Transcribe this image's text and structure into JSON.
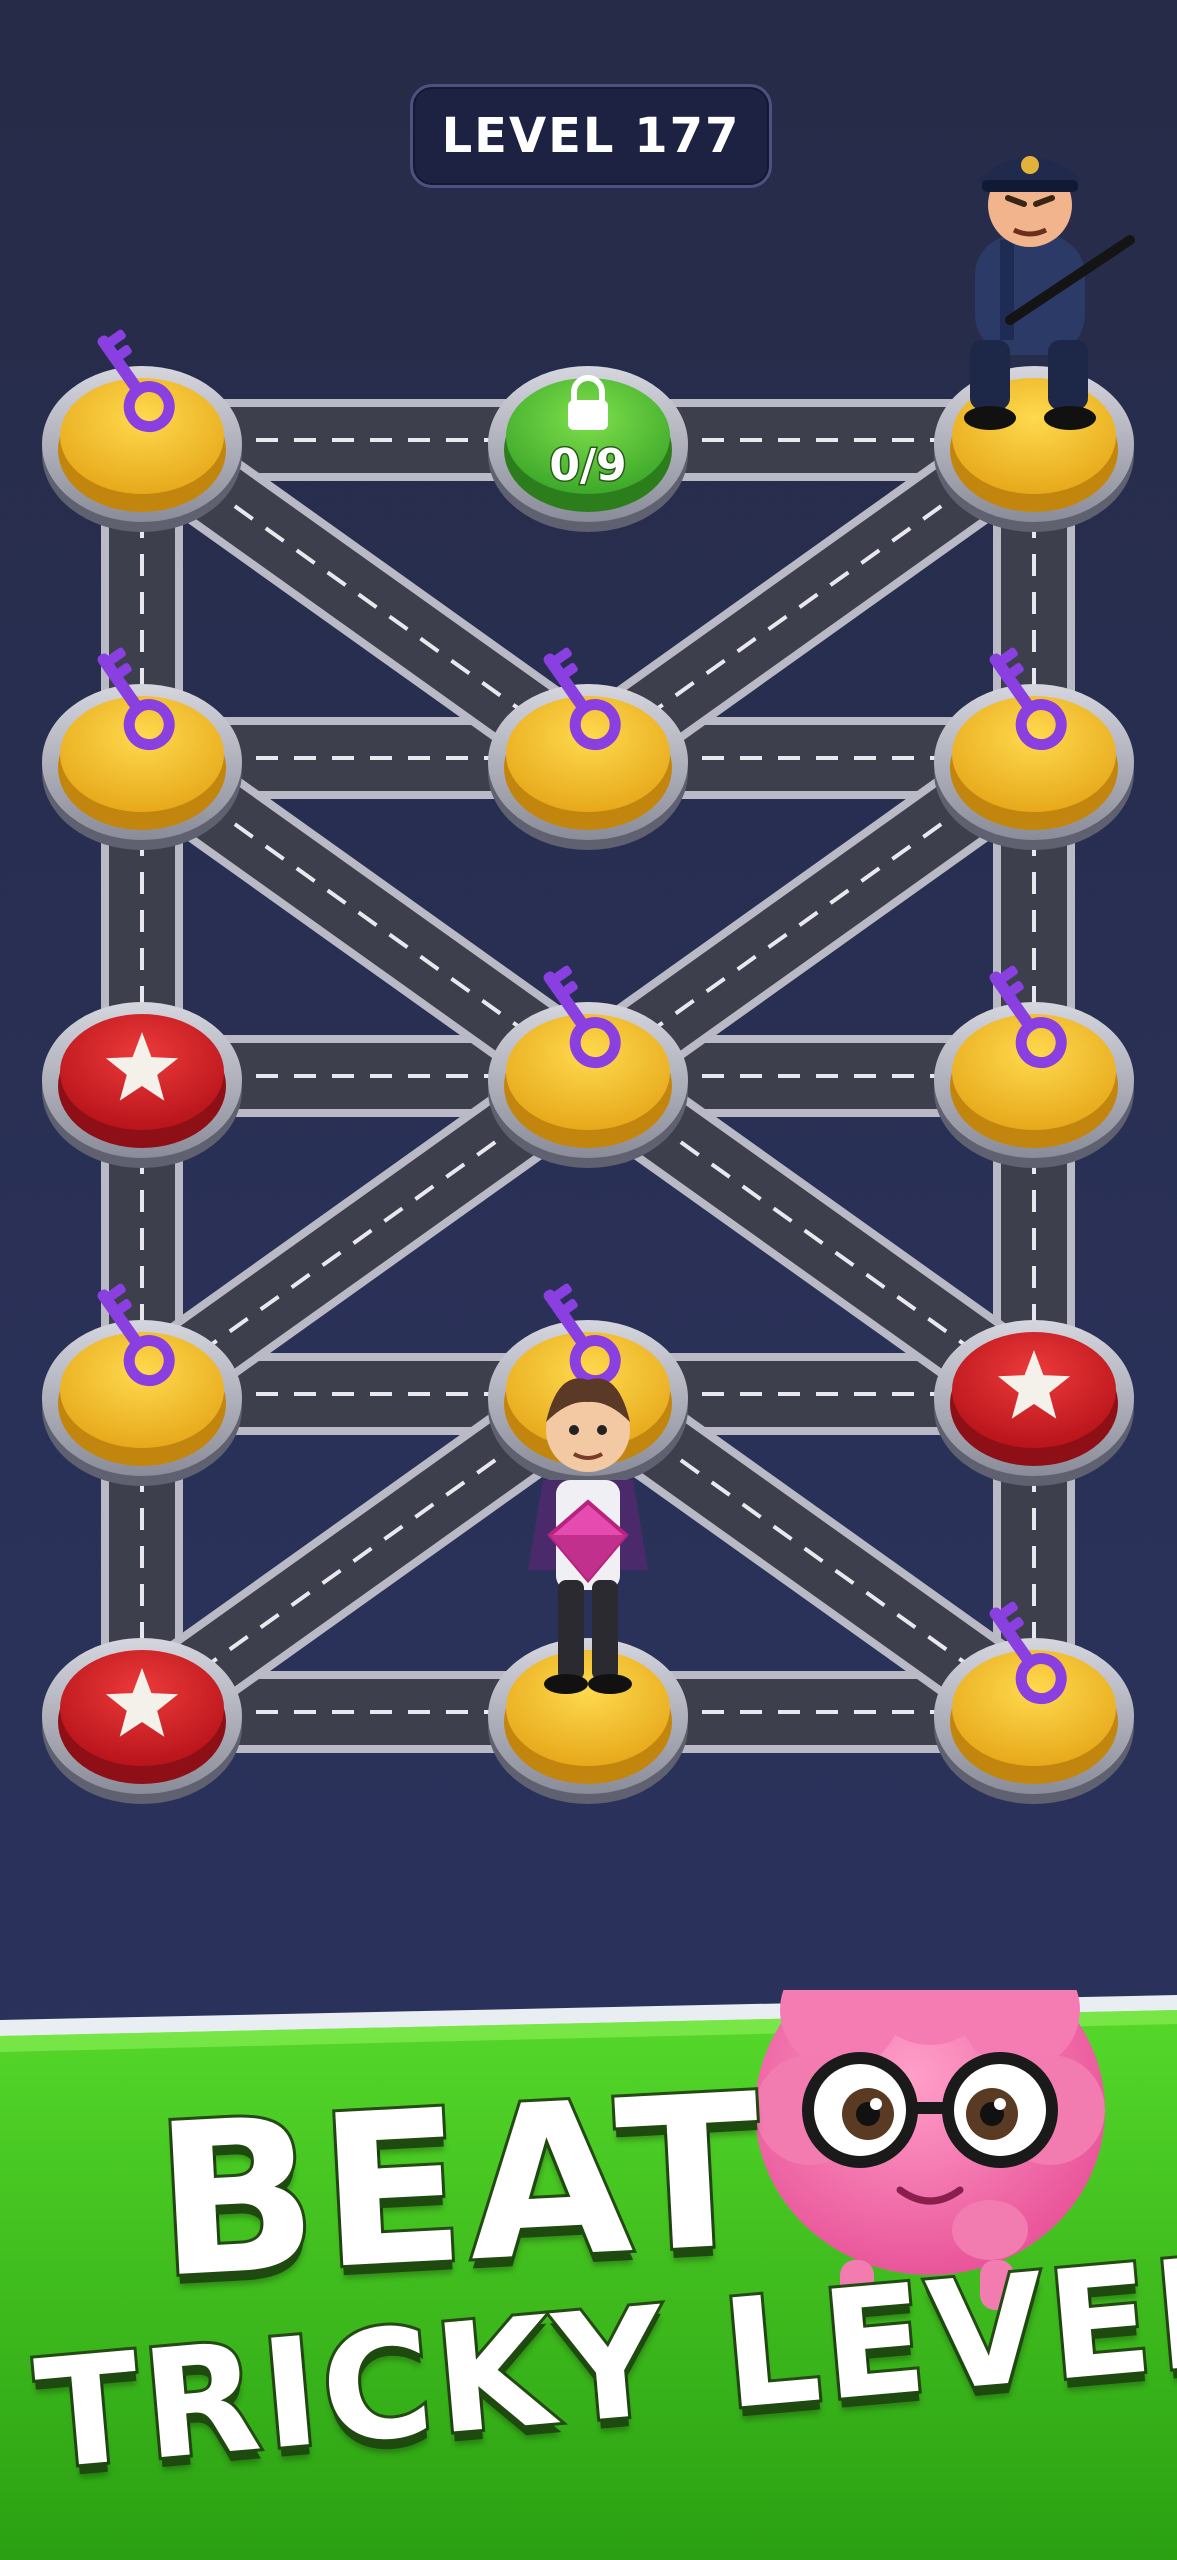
{
  "level": {
    "label": "LEVEL 177"
  },
  "lock_counter": "0/9",
  "board": {
    "nodes": [
      {
        "id": "n00",
        "col": 0,
        "row": 0,
        "type": "yellow",
        "item": "key"
      },
      {
        "id": "n01",
        "col": 1,
        "row": 0,
        "type": "green-lock",
        "item": "lock-counter"
      },
      {
        "id": "n02",
        "col": 2,
        "row": 0,
        "type": "yellow",
        "item": "police"
      },
      {
        "id": "n10",
        "col": 0,
        "row": 1,
        "type": "yellow",
        "item": "key"
      },
      {
        "id": "n11",
        "col": 1,
        "row": 1,
        "type": "yellow",
        "item": "key"
      },
      {
        "id": "n12",
        "col": 2,
        "row": 1,
        "type": "yellow",
        "item": "key"
      },
      {
        "id": "n20",
        "col": 0,
        "row": 2,
        "type": "red",
        "item": "star"
      },
      {
        "id": "n21",
        "col": 1,
        "row": 2,
        "type": "yellow",
        "item": "key"
      },
      {
        "id": "n22",
        "col": 2,
        "row": 2,
        "type": "yellow",
        "item": "key"
      },
      {
        "id": "n30",
        "col": 0,
        "row": 3,
        "type": "yellow",
        "item": "key"
      },
      {
        "id": "n31",
        "col": 1,
        "row": 3,
        "type": "yellow",
        "item": "key"
      },
      {
        "id": "n32",
        "col": 2,
        "row": 3,
        "type": "red",
        "item": "star"
      },
      {
        "id": "n40",
        "col": 0,
        "row": 4,
        "type": "red",
        "item": "star"
      },
      {
        "id": "n41",
        "col": 1,
        "row": 4,
        "type": "yellow",
        "item": "thief"
      },
      {
        "id": "n42",
        "col": 2,
        "row": 4,
        "type": "yellow",
        "item": "key"
      }
    ],
    "roads": [
      [
        "n00",
        "n01"
      ],
      [
        "n01",
        "n02"
      ],
      [
        "n10",
        "n11"
      ],
      [
        "n11",
        "n12"
      ],
      [
        "n20",
        "n21"
      ],
      [
        "n21",
        "n22"
      ],
      [
        "n30",
        "n31"
      ],
      [
        "n31",
        "n32"
      ],
      [
        "n40",
        "n41"
      ],
      [
        "n41",
        "n42"
      ],
      [
        "n00",
        "n10"
      ],
      [
        "n10",
        "n20"
      ],
      [
        "n20",
        "n30"
      ],
      [
        "n30",
        "n40"
      ],
      [
        "n02",
        "n12"
      ],
      [
        "n12",
        "n22"
      ],
      [
        "n22",
        "n32"
      ],
      [
        "n32",
        "n42"
      ],
      [
        "n00",
        "n11"
      ],
      [
        "n02",
        "n11"
      ],
      [
        "n10",
        "n21"
      ],
      [
        "n12",
        "n21"
      ],
      [
        "n21",
        "n30"
      ],
      [
        "n21",
        "n32"
      ],
      [
        "n31",
        "n40"
      ],
      [
        "n31",
        "n42"
      ]
    ]
  },
  "banner": {
    "line1": "BEAT",
    "line2": "TRICKY LEVELS!"
  },
  "colors": {
    "background": "#262b47",
    "road": "#3e3f4c",
    "node_yellow": "#f6c53a",
    "node_red": "#d8262a",
    "node_green": "#5ac63a",
    "key": "#8a3fe0",
    "banner_green": "#47c824"
  },
  "characters": [
    "police-officer",
    "thief-with-gem",
    "brain-mascot"
  ]
}
